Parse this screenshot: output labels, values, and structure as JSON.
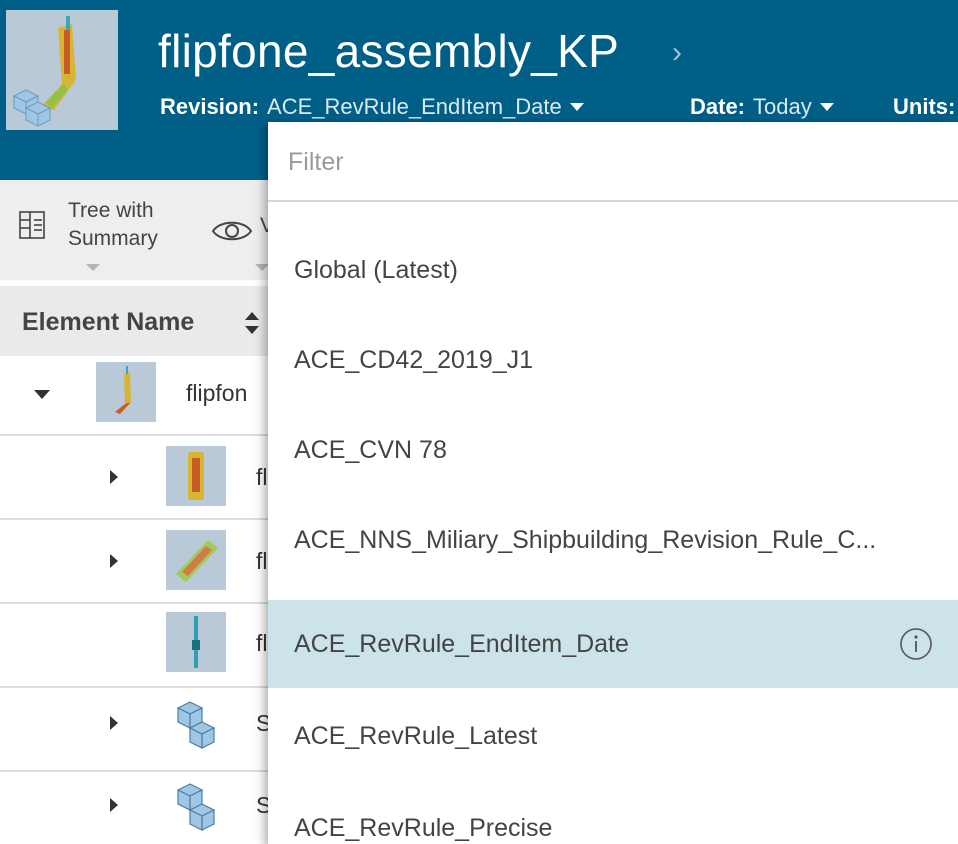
{
  "header": {
    "title": "flipfone_assembly_KP",
    "revision_label": "Revision:",
    "revision_value": "ACE_RevRule_EndItem_Date",
    "date_label": "Date:",
    "date_value": "Today",
    "units_label": "Units:"
  },
  "toolbar": {
    "view_mode_line1": "Tree with",
    "view_mode_line2": "Summary",
    "visibility_partial": "V"
  },
  "table": {
    "column_header": "Element Name",
    "rows": [
      {
        "name": "flipfon",
        "expander": "expanded"
      },
      {
        "name": "fl",
        "expander": "collapsed"
      },
      {
        "name": "fl",
        "expander": "collapsed"
      },
      {
        "name": "fl",
        "expander": "none"
      },
      {
        "name": "S",
        "expander": "collapsed"
      },
      {
        "name": "S",
        "expander": "collapsed"
      }
    ]
  },
  "dropdown": {
    "filter_placeholder": "Filter",
    "options": [
      {
        "label": "Global (Latest)"
      },
      {
        "label": "ACE_CD42_2019_J1"
      },
      {
        "label": "ACE_CVN 78"
      },
      {
        "label": "ACE_NNS_Miliary_Shipbuilding_Revision_Rule_C..."
      },
      {
        "label": "ACE_RevRule_EndItem_Date",
        "selected": true
      },
      {
        "label": "ACE_RevRule_Latest"
      },
      {
        "label": "ACE_RevRule_Precise"
      }
    ]
  },
  "colors": {
    "header_bg": "#005f87",
    "selected_option_bg": "#cce3ea",
    "thumbnail_bg": "#b9c9d8"
  }
}
